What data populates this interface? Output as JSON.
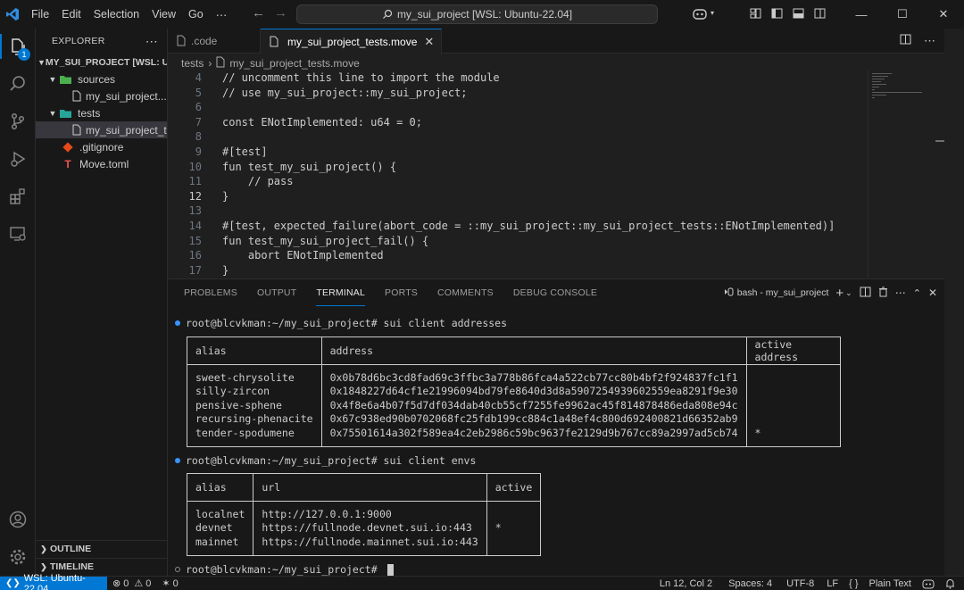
{
  "titlebar": {
    "menu": [
      "File",
      "Edit",
      "Selection",
      "View",
      "Go",
      "⋯"
    ],
    "command_center": "my_sui_project [WSL: Ubuntu-22.04]"
  },
  "activity": {
    "explorer_badge": "1"
  },
  "sidebar": {
    "title": "EXPLORER",
    "more": "⋯",
    "root": "MY_SUI_PROJECT [WSL: U...",
    "items": [
      {
        "label": "sources"
      },
      {
        "label": "my_sui_project...."
      },
      {
        "label": "tests"
      },
      {
        "label": "my_sui_project_t..."
      },
      {
        "label": ".gitignore"
      },
      {
        "label": "Move.toml"
      }
    ],
    "outline": "OUTLINE",
    "timeline": "TIMELINE"
  },
  "tabs": [
    {
      "label": ".code"
    },
    {
      "label": "my_sui_project_tests.move"
    }
  ],
  "breadcrumb": [
    "tests",
    "my_sui_project_tests.move"
  ],
  "editor": {
    "current_line": 12,
    "lines": [
      {
        "n": "4",
        "text": "// uncomment this line to import the module"
      },
      {
        "n": "5",
        "text": "// use my_sui_project::my_sui_project;"
      },
      {
        "n": "6",
        "text": ""
      },
      {
        "n": "7",
        "text": "const ENotImplemented: u64 = 0;"
      },
      {
        "n": "8",
        "text": ""
      },
      {
        "n": "9",
        "text": "#[test]"
      },
      {
        "n": "10",
        "text": "fun test_my_sui_project() {"
      },
      {
        "n": "11",
        "text": "    // pass"
      },
      {
        "n": "12",
        "text": "}"
      },
      {
        "n": "13",
        "text": ""
      },
      {
        "n": "14",
        "text": "#[test, expected_failure(abort_code = ::my_sui_project::my_sui_project_tests::ENotImplemented)]"
      },
      {
        "n": "15",
        "text": "fun test_my_sui_project_fail() {"
      },
      {
        "n": "16",
        "text": "    abort ENotImplemented"
      },
      {
        "n": "17",
        "text": "}"
      }
    ]
  },
  "panel": {
    "tabs": [
      "PROBLEMS",
      "OUTPUT",
      "TERMINAL",
      "PORTS",
      "COMMENTS",
      "DEBUG CONSOLE"
    ],
    "active_tab": "TERMINAL",
    "terminal_name": "bash - my_sui_project"
  },
  "terminal": {
    "prompt1": "root@blcvkman:~/my_sui_project# sui client addresses",
    "addresses_table": {
      "headers": [
        "alias",
        "address",
        "active address"
      ],
      "aliases": "sweet-chrysolite\nsilly-zircon\npensive-sphene\nrecursing-phenacite\ntender-spodumene",
      "addresses": "0x0b78d6bc3cd8fad69c3ffbc3a778b86fca4a522cb77cc80b4bf2f924837fc1f1\n0x1848227d64cf1e21996094bd79fe8640d3d8a5907254939602559ea8291f9e30\n0x4f8e6a4b07f5d7df034dab40cb55cf7255fe9962ac45f814878486eda808e94c\n0x67c938ed90b0702068fc25fdb199cc884c1a48ef4c800d692400821d66352ab9\n0x75501614a302f589ea4c2eb2986c59bc9637fe2129d9b767cc89a2997ad5cb74",
      "active": "\n\n\n\n*"
    },
    "prompt2": "root@blcvkman:~/my_sui_project# sui client envs",
    "envs_table": {
      "headers": [
        "alias",
        "url",
        "active"
      ],
      "aliases": "localnet\ndevnet\nmainnet",
      "urls": "http://127.0.0.1:9000\nhttps://fullnode.devnet.sui.io:443\nhttps://fullnode.mainnet.sui.io:443",
      "active": "\n*\n"
    },
    "prompt3": "root@blcvkman:~/my_sui_project# "
  },
  "status": {
    "remote": "WSL: Ubuntu-22.04",
    "errors": "0",
    "warnings": "0",
    "ports": "0",
    "position": "Ln 12, Col 2",
    "spaces": "Spaces: 4",
    "encoding": "UTF-8",
    "eol": "LF",
    "language": "Plain Text"
  }
}
